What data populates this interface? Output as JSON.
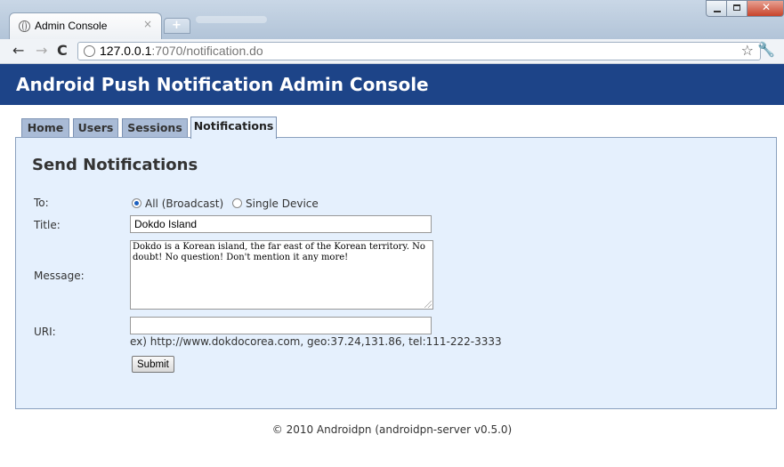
{
  "browser": {
    "tab_title": "Admin Console",
    "tab_close": "×",
    "newtab_label": "+",
    "url_host": "127.0.0.1",
    "url_rest": ":7070/notification.do"
  },
  "header": {
    "title": "Android Push Notification Admin Console"
  },
  "tabs": [
    {
      "label": "Home"
    },
    {
      "label": "Users"
    },
    {
      "label": "Sessions"
    },
    {
      "label": "Notifications",
      "active": true
    }
  ],
  "form": {
    "heading": "Send Notifications",
    "to_label": "To:",
    "to_options": [
      {
        "label": "All (Broadcast)",
        "checked": true
      },
      {
        "label": "Single Device",
        "checked": false
      }
    ],
    "title_label": "Title:",
    "title_value": "Dokdo Island",
    "message_label": "Message:",
    "message_value": "Dokdo is a Korean island, the far east of the Korean territory. No doubt! No question! Don't mention it any more!",
    "uri_label": "URI:",
    "uri_value": "",
    "uri_hint": "ex) http://www.dokdocorea.com, geo:37.24,131.86, tel:111-222-3333",
    "submit_label": "Submit"
  },
  "footer": {
    "text": "© 2010 Androidpn (androidpn-server v0.5.0)"
  },
  "colors": {
    "header_bg": "#1d4488",
    "panel_bg": "#e5f0fd",
    "tab_bg": "#a9bbd6"
  }
}
